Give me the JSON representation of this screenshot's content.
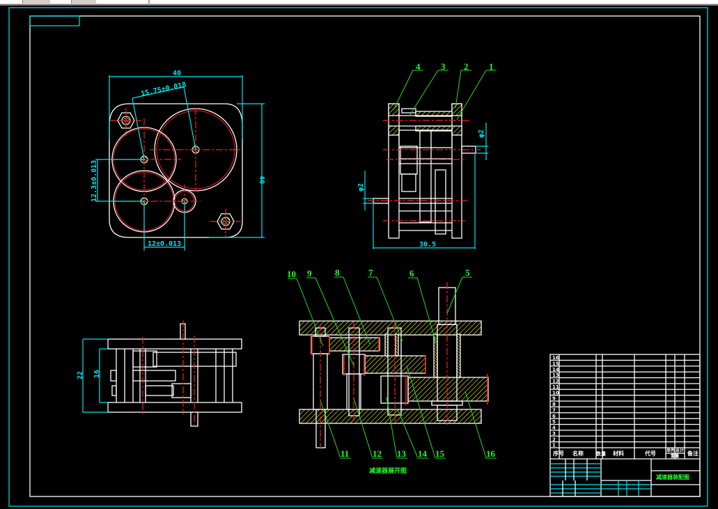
{
  "colors": {
    "background": "#000000",
    "outline": "#ffffff",
    "dimension": "#00e5ee",
    "centerline": "#ff1a1a",
    "leader": "#22dd22",
    "hatch": "#ffff33"
  },
  "top_view": {
    "dims": {
      "width": "40",
      "height": "40",
      "center_a": "15.75±0.018",
      "center_b": "12.3±0.013",
      "center_c": "12±0.013"
    }
  },
  "side_view": {
    "dims": {
      "length": "30.5",
      "shaft_left": "φ2",
      "shaft_right": "φ2"
    },
    "labels": [
      "4",
      "3",
      "2",
      "1"
    ]
  },
  "front_view": {
    "dims": {
      "outer": "22",
      "inner": "16"
    }
  },
  "section_view": {
    "labels_top": [
      "10",
      "9",
      "8",
      "7",
      "6",
      "5"
    ],
    "labels_bottom": [
      "11",
      "12",
      "13",
      "14",
      "15",
      "16"
    ],
    "caption": "减速器展开图"
  },
  "parts_table": {
    "rows": [
      "16",
      "15",
      "14",
      "13",
      "12",
      "11",
      "10",
      "9",
      "8",
      "7",
      "6",
      "5",
      "4",
      "3",
      "2",
      "1"
    ],
    "header": {
      "seq": "序号",
      "name": "名称",
      "qty": "数量",
      "material": "材料",
      "code": "代号",
      "unit": "单件",
      "total": "总计",
      "weight": "重量",
      "remark": "备注"
    },
    "title": "减速器装配图"
  }
}
